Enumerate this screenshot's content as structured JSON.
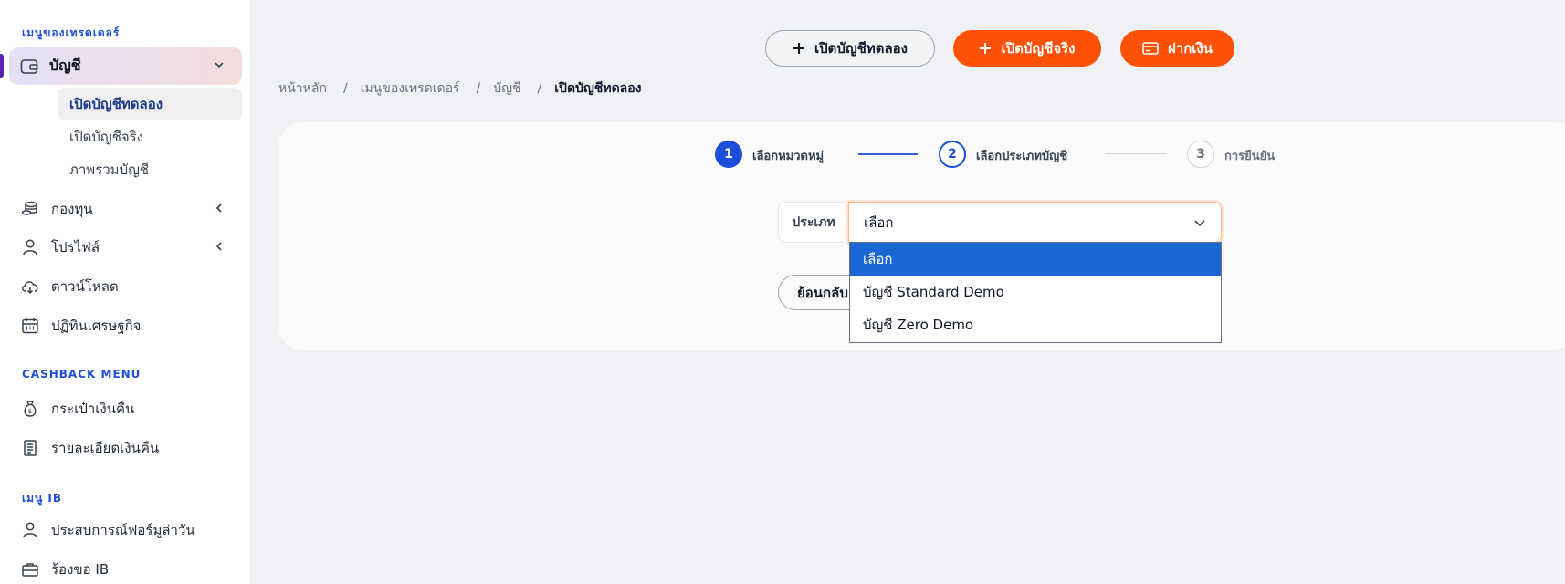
{
  "sidebar": {
    "trader_menu_title": "เมนูของเทรดเดอร์",
    "account": {
      "label": "บัญชี",
      "icon": "wallet-icon"
    },
    "account_sub": [
      {
        "label": "เปิดบัญชีทดลอง",
        "active": true
      },
      {
        "label": "เปิดบัญชีจริง",
        "active": false
      },
      {
        "label": "ภาพรวมบัญชี",
        "active": false
      }
    ],
    "items": [
      {
        "label": "กองทุน",
        "icon": "coins-icon"
      },
      {
        "label": "โปรไฟล์",
        "icon": "user-icon"
      },
      {
        "label": "ดาวน์โหลด",
        "icon": "cloud-download-icon"
      },
      {
        "label": "ปฏิทินเศรษฐกิจ",
        "icon": "calendar-icon"
      }
    ],
    "cashback_title": "CASHBACK MENU",
    "cashback_items": [
      {
        "label": "กระเป๋าเงินคืน",
        "icon": "money-bag-icon"
      },
      {
        "label": "รายละเอียดเงินคืน",
        "icon": "receipt-icon"
      }
    ],
    "ib_title": "เมนู IB",
    "ib_items": [
      {
        "label": "ประสบการณ์ฟอร์มูล่าวัน",
        "icon": "user-icon"
      },
      {
        "label": "ร้องขอ IB",
        "icon": "briefcase-icon"
      }
    ]
  },
  "toolbar": {
    "demo_label": "เปิดบัญชีทดลอง",
    "real_label": "เปิดบัญชีจริง",
    "deposit_label": "ฝากเงิน"
  },
  "breadcrumb": [
    "หน้าหลัก",
    "เมนูของเทรดเดอร์",
    "บัญชี",
    "เปิดบัญชีทดลอง"
  ],
  "stepper": [
    {
      "num": "1",
      "label": "เลือกหมวดหมู่"
    },
    {
      "num": "2",
      "label": "เลือกประเภทบัญชี"
    },
    {
      "num": "3",
      "label": "การยืนยัน"
    }
  ],
  "form": {
    "type_label": "ประเภท",
    "selected_value": "เลือก",
    "options": [
      "เลือก",
      "บัญชี Standard Demo",
      "บัญชี Zero Demo"
    ],
    "back_label": "ย้อนกลับ"
  },
  "colors": {
    "accent": "#1d4ed8",
    "brand_orange": "#ff5208",
    "option_highlight": "#1a66d2"
  }
}
